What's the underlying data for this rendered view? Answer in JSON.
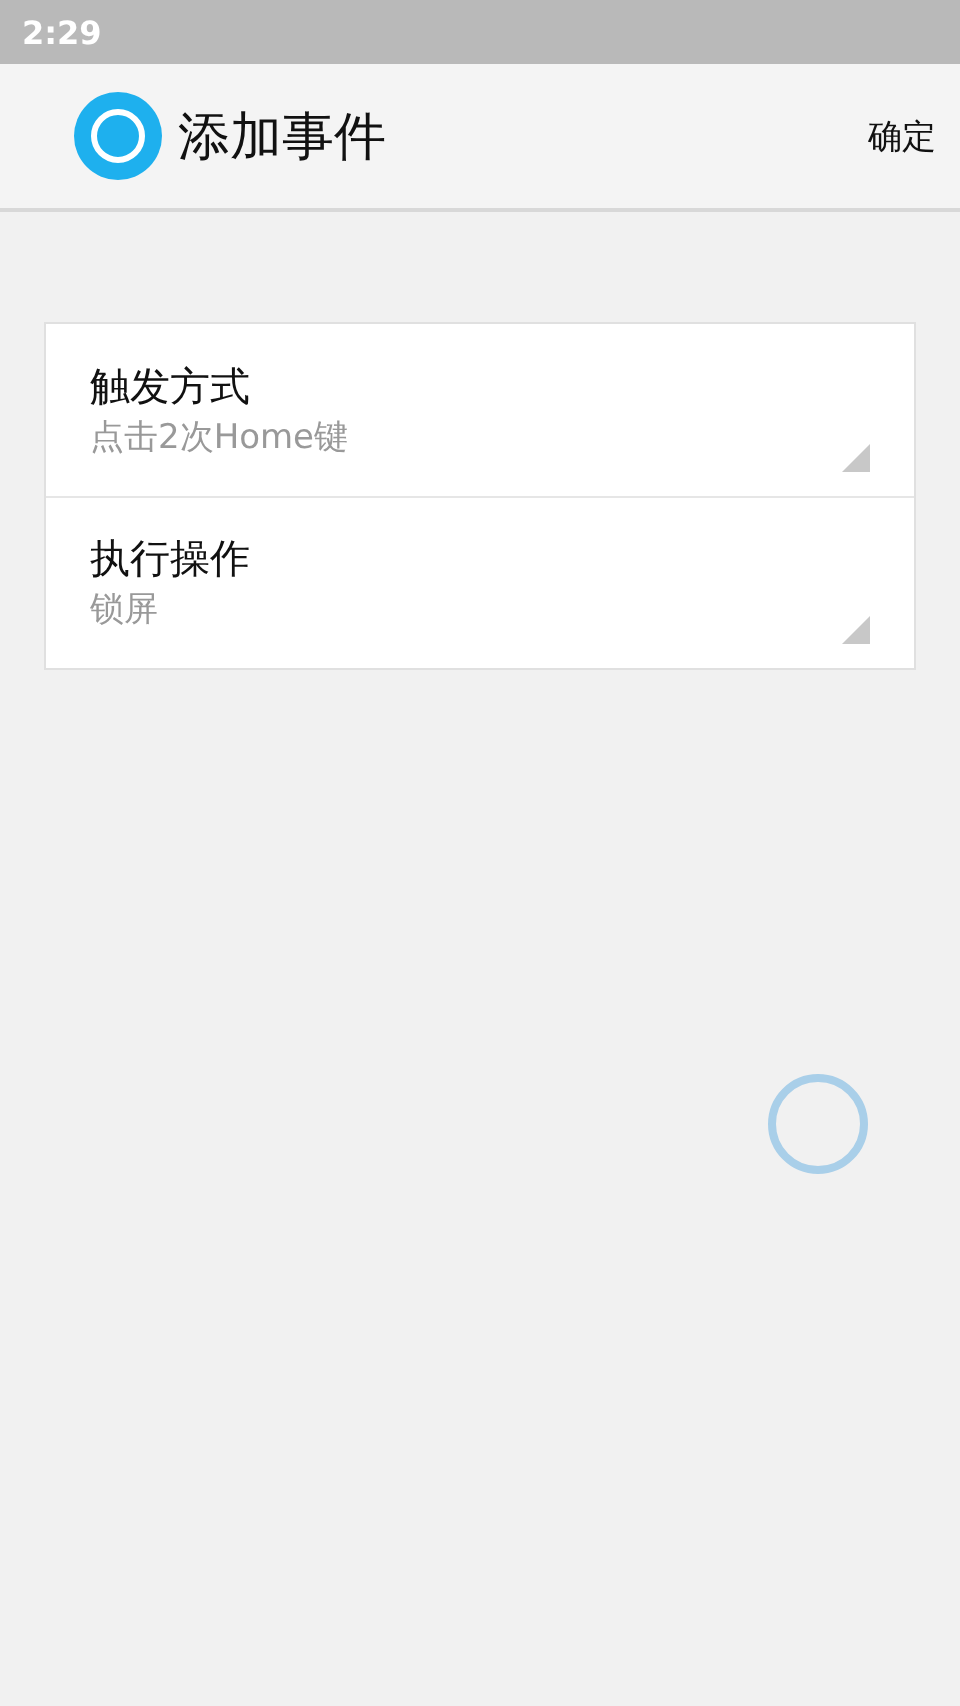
{
  "status_bar": {
    "time": "2:29"
  },
  "header": {
    "title": "添加事件",
    "action": "确定"
  },
  "settings": [
    {
      "label": "触发方式",
      "value": "点击2次Home键"
    },
    {
      "label": "执行操作",
      "value": "锁屏"
    }
  ],
  "floating_button": {
    "kind": "ring"
  }
}
